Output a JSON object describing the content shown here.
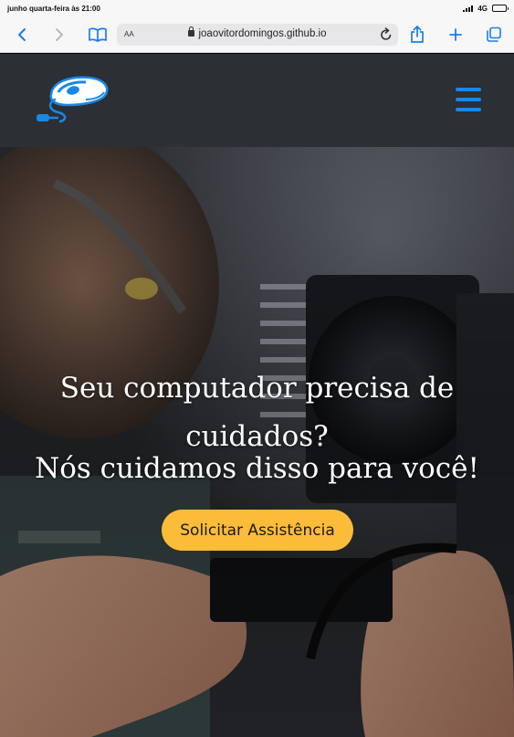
{
  "status_bar": {
    "datetime": "junho quarta-feira às 21:00",
    "network": "4G"
  },
  "browser": {
    "text_size_label": "AA",
    "url": "joaovitordomingos.github.io",
    "icons": [
      "back-icon",
      "forward-icon",
      "bookmarks-icon",
      "lock-icon",
      "reload-icon",
      "share-icon",
      "new-tab-icon",
      "tabs-icon"
    ]
  },
  "site": {
    "header_bg": "#2c2f33",
    "accent": "#1788e8",
    "hero": {
      "headline": "Seu computador precisa de cuidados?",
      "subheadline": "Nós cuidamos disso para você!",
      "cta_label": "Solicitar Assistência",
      "cta_color": "#fbbc3a"
    }
  }
}
